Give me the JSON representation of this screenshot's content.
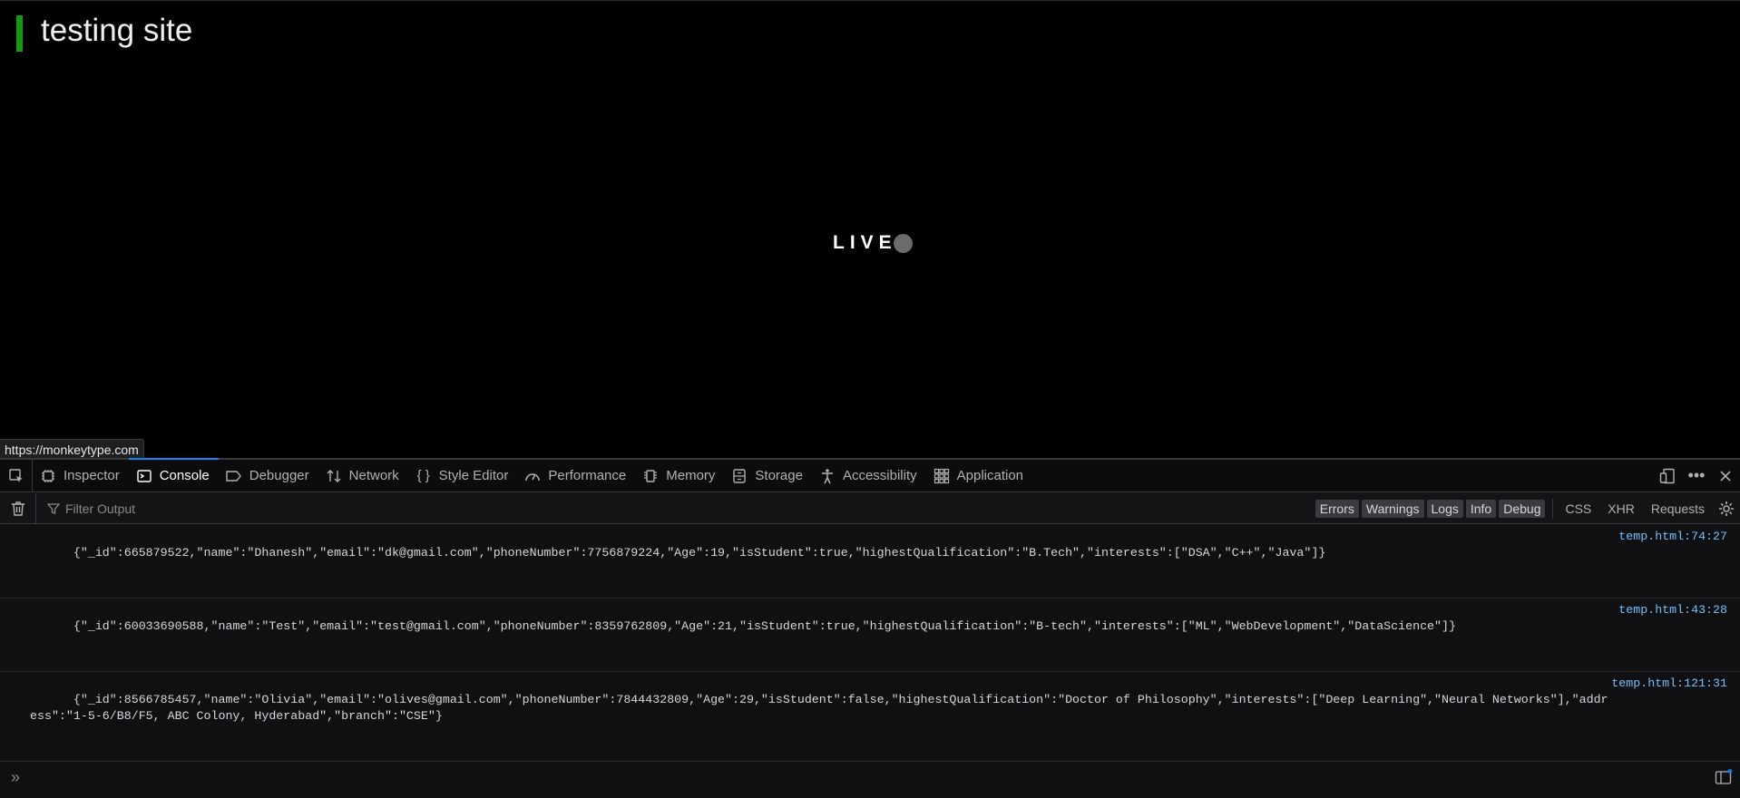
{
  "page": {
    "heading": "testing site",
    "live_label": "LIVE",
    "status_url": "https://monkeytype.com"
  },
  "devtools": {
    "tabs": [
      {
        "label": "Inspector",
        "icon": "inspector-icon"
      },
      {
        "label": "Console",
        "icon": "console-icon",
        "selected": true
      },
      {
        "label": "Debugger",
        "icon": "debugger-icon"
      },
      {
        "label": "Network",
        "icon": "network-icon"
      },
      {
        "label": "Style Editor",
        "icon": "style-editor-icon"
      },
      {
        "label": "Performance",
        "icon": "performance-icon"
      },
      {
        "label": "Memory",
        "icon": "memory-icon"
      },
      {
        "label": "Storage",
        "icon": "storage-icon"
      },
      {
        "label": "Accessibility",
        "icon": "accessibility-icon"
      },
      {
        "label": "Application",
        "icon": "application-icon"
      }
    ],
    "filter_placeholder": "Filter Output",
    "levels": [
      "Errors",
      "Warnings",
      "Logs",
      "Info",
      "Debug"
    ],
    "request_filters": [
      "CSS",
      "XHR",
      "Requests"
    ],
    "logs": [
      {
        "text": "{\"_id\":665879522,\"name\":\"Dhanesh\",\"email\":\"dk@gmail.com\",\"phoneNumber\":7756879224,\"Age\":19,\"isStudent\":true,\"highestQualification\":\"B.Tech\",\"interests\":[\"DSA\",\"C++\",\"Java\"]}",
        "location": "temp.html:74:27"
      },
      {
        "text": "{\"_id\":60033690588,\"name\":\"Test\",\"email\":\"test@gmail.com\",\"phoneNumber\":8359762809,\"Age\":21,\"isStudent\":true,\"highestQualification\":\"B-tech\",\"interests\":[\"ML\",\"WebDevelopment\",\"DataScience\"]}",
        "location": "temp.html:43:28"
      },
      {
        "text": "{\"_id\":8566785457,\"name\":\"Olivia\",\"email\":\"olives@gmail.com\",\"phoneNumber\":7844432809,\"Age\":29,\"isStudent\":false,\"highestQualification\":\"Doctor of Philosophy\",\"interests\":[\"Deep Learning\",\"Neural Networks\"],\"address\":\"1-5-6/B8/F5, ABC Colony, Hyderabad\",\"branch\":\"CSE\"}",
        "location": "temp.html:121:31"
      }
    ],
    "prompt_symbol": "»",
    "colors": {
      "accent": "#0a84ff",
      "link": "#75bfff",
      "heading_bar": "#139c12"
    }
  }
}
